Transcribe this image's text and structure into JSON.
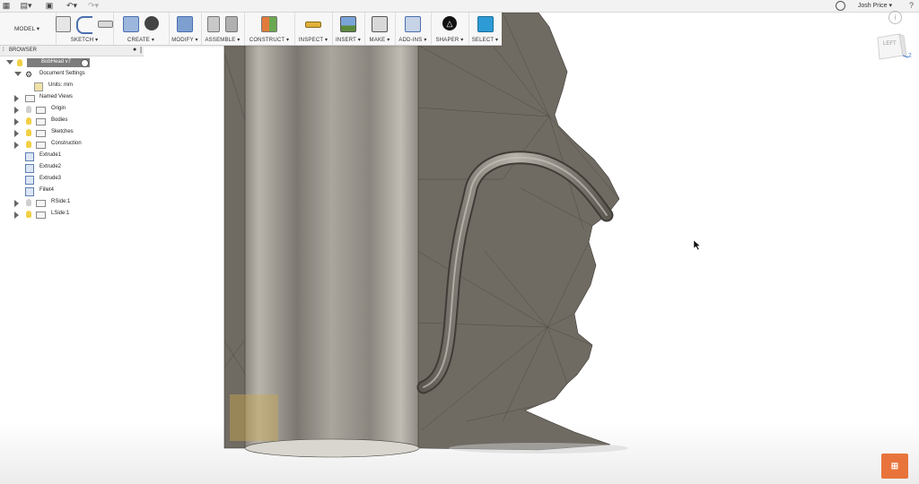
{
  "topbar": {
    "user_name": "Josh Price ▾",
    "help_glyph": "?"
  },
  "toolbar": {
    "workspace": "MODEL ▾",
    "groups": [
      {
        "label": "SKETCH ▾"
      },
      {
        "label": "CREATE ▾"
      },
      {
        "label": "MODIFY ▾"
      },
      {
        "label": "ASSEMBLE ▾"
      },
      {
        "label": "CONSTRUCT ▾"
      },
      {
        "label": "INSPECT ▾"
      },
      {
        "label": "INSERT ▾"
      },
      {
        "label": "MAKE ▾"
      },
      {
        "label": "ADD-INS ▾"
      },
      {
        "label": "SHAPER ▾"
      },
      {
        "label": "SELECT ▾"
      }
    ]
  },
  "browser": {
    "title": "BROWSER",
    "root": "BobHead v7",
    "items": [
      {
        "label": "Document Settings"
      },
      {
        "label": "Units: mm"
      },
      {
        "label": "Named Views"
      },
      {
        "label": "Origin"
      },
      {
        "label": "Bodies"
      },
      {
        "label": "Sketches"
      },
      {
        "label": "Construction"
      },
      {
        "label": "Extrude1"
      },
      {
        "label": "Extrude2"
      },
      {
        "label": "Extrude3"
      },
      {
        "label": "Fillet4"
      },
      {
        "label": "RSide:1"
      },
      {
        "label": "LSide:1"
      }
    ]
  },
  "viewcube": {
    "face": "LEFT",
    "axis": "Z"
  },
  "colors": {
    "model": "#6f6a62",
    "accent": "#2e9bd6",
    "badge": "#e8743b"
  }
}
